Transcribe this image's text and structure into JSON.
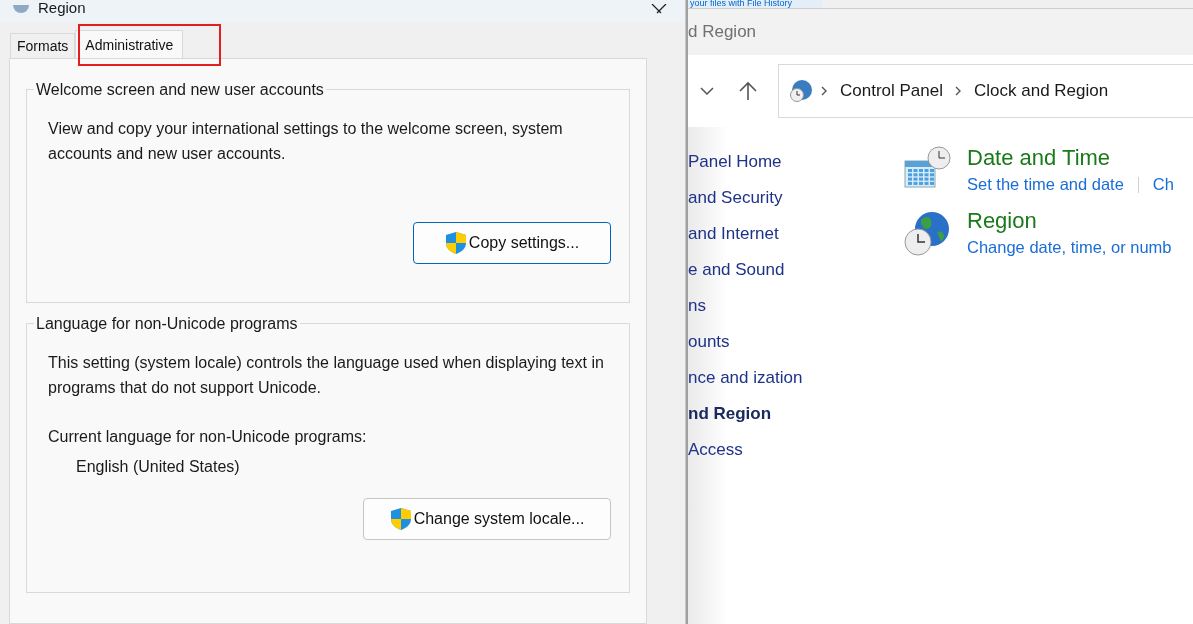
{
  "dialog": {
    "title": "Region",
    "tabs": [
      {
        "label": "Formats",
        "selected": false
      },
      {
        "label": "Administrative",
        "selected": true
      }
    ],
    "groups": [
      {
        "title": "Welcome screen and new user accounts",
        "text": "View and copy your international settings to the welcome screen, system accounts and new user accounts.",
        "button": "Copy settings...",
        "focused": true
      },
      {
        "title": "Language for non-Unicode programs",
        "text": "This setting (system locale) controls the language used when displaying text in programs that do not support Unicode.",
        "current_label": "Current language for non-Unicode programs:",
        "current_value": "English (United States)",
        "button": "Change system locale...",
        "focused": false
      }
    ]
  },
  "window": {
    "banner_link": "your files with File History",
    "title": "d Region",
    "breadcrumb": [
      "Control Panel",
      "Clock and Region"
    ],
    "sidebar": [
      {
        "label": "Panel Home",
        "selected": false
      },
      {
        "label": "and Security",
        "selected": false
      },
      {
        "label": "and Internet",
        "selected": false
      },
      {
        "label": "e and Sound",
        "selected": false
      },
      {
        "label": "ns",
        "selected": false
      },
      {
        "label": "ounts",
        "selected": false
      },
      {
        "label": "nce and ization",
        "selected": false
      },
      {
        "label": "nd Region",
        "selected": true
      },
      {
        "label": "Access",
        "selected": false
      }
    ],
    "categories": [
      {
        "kind": "datetime",
        "title": "Date and Time",
        "links": [
          "Set the time and date",
          "Ch"
        ]
      },
      {
        "kind": "region",
        "title": "Region",
        "links": [
          "Change date, time, or numb"
        ]
      }
    ]
  }
}
